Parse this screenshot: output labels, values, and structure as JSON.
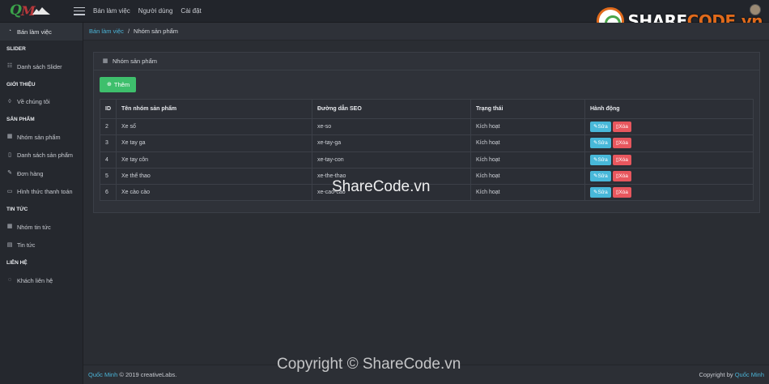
{
  "topbar": {
    "nav": [
      "Bán làm việc",
      "Người dùng",
      "Cài đặt"
    ]
  },
  "watermark_logo": {
    "prefix": "SHARE",
    "suffix": "CODE.vn"
  },
  "sidebar": {
    "active": "Bán làm việc",
    "sections": [
      {
        "heading": "SLIDER",
        "items": [
          {
            "label": "Danh sách Slider",
            "icon": "sliders-icon"
          }
        ]
      },
      {
        "heading": "GIỚI THIỆU",
        "items": [
          {
            "label": "Về chúng tôi",
            "icon": "drop-icon"
          }
        ]
      },
      {
        "heading": "SẢN PHẨM",
        "items": [
          {
            "label": "Nhóm sản phẩm",
            "icon": "grid-icon"
          },
          {
            "label": "Danh sách sản phẩm",
            "icon": "clipboard-icon"
          },
          {
            "label": "Đơn hàng",
            "icon": "edit-icon"
          },
          {
            "label": "Hình thức thanh toán",
            "icon": "card-icon"
          }
        ]
      },
      {
        "heading": "TIN TỨC",
        "items": [
          {
            "label": "Nhóm tin tức",
            "icon": "grid-icon"
          },
          {
            "label": "Tin tức",
            "icon": "news-icon"
          }
        ]
      },
      {
        "heading": "LIÊN HỆ",
        "items": [
          {
            "label": "Khách liên hệ",
            "icon": "chat-icon"
          }
        ]
      }
    ]
  },
  "breadcrumb": {
    "root": "Bán làm việc",
    "separator": "/",
    "current": "Nhóm sản phẩm"
  },
  "card": {
    "title": "Nhóm sản phẩm",
    "add_label": "Thêm",
    "columns": [
      "ID",
      "Tên nhóm sản phẩm",
      "Đường dẫn SEO",
      "Trạng thái",
      "Hành động"
    ],
    "rows": [
      {
        "id": "2",
        "name": "Xe số",
        "seo": "xe-so",
        "status": "Kích hoạt"
      },
      {
        "id": "3",
        "name": "Xe tay ga",
        "seo": "xe-tay-ga",
        "status": "Kích hoạt"
      },
      {
        "id": "4",
        "name": "Xe tay côn",
        "seo": "xe-tay-con",
        "status": "Kích hoạt"
      },
      {
        "id": "5",
        "name": "Xe thể thao",
        "seo": "xe-the-thao",
        "status": "Kích hoạt"
      },
      {
        "id": "6",
        "name": "Xe cào cào",
        "seo": "xe-cao-cao",
        "status": "Kích hoạt"
      }
    ],
    "edit_label": "Sửa",
    "delete_label": "Xóa"
  },
  "watermark": {
    "center": "ShareCode.vn",
    "bottom": "Copyright © ShareCode.vn"
  },
  "footer": {
    "left_link": "Quốc Minh",
    "left_text": "© 2019 creativeLabs.",
    "right_text": "Copyright by",
    "right_link": "Quốc Minh"
  }
}
